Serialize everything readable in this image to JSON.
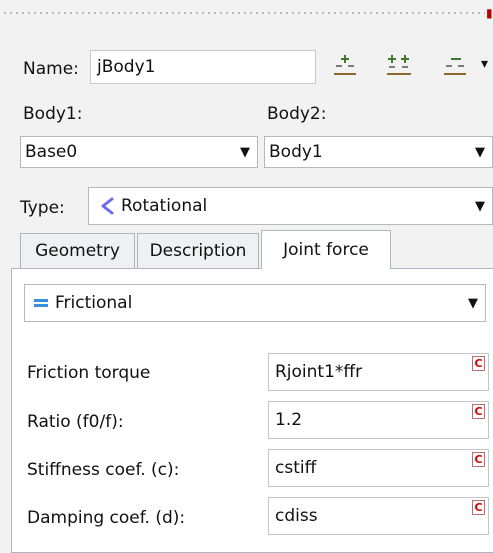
{
  "header": {
    "name_label": "Name:",
    "name_value": "jBody1"
  },
  "toolbar": {
    "icons": [
      "add-icon",
      "add-multiple-icon",
      "remove-icon"
    ],
    "overflow_icon": "chevron-down-icon"
  },
  "bodies": {
    "body1_label": "Body1:",
    "body2_label": "Body2:",
    "body1_value": "Base0",
    "body2_value": "Body1"
  },
  "type": {
    "label": "Type:",
    "value": "Rotational",
    "icon": "rotational-icon",
    "icon_color": "#6b6bf0"
  },
  "tabs": [
    {
      "label": "Geometry",
      "active": false
    },
    {
      "label": "Description",
      "active": false
    },
    {
      "label": "Joint force",
      "active": true
    }
  ],
  "joint_force": {
    "kind": "Frictional",
    "kind_icon": "frictional-icon",
    "kind_icon_color": "#3a8fe0",
    "rows": [
      {
        "label": "Friction torque",
        "value": "Rjoint1*ffr",
        "badge": "C"
      },
      {
        "label": "Ratio (f0/f):",
        "value": "1.2",
        "badge": "C"
      },
      {
        "label": "Stiffness coef. (c):",
        "value": "cstiff",
        "badge": "C"
      },
      {
        "label": "Damping coef. (d):",
        "value": "cdiss",
        "badge": "C"
      }
    ]
  }
}
